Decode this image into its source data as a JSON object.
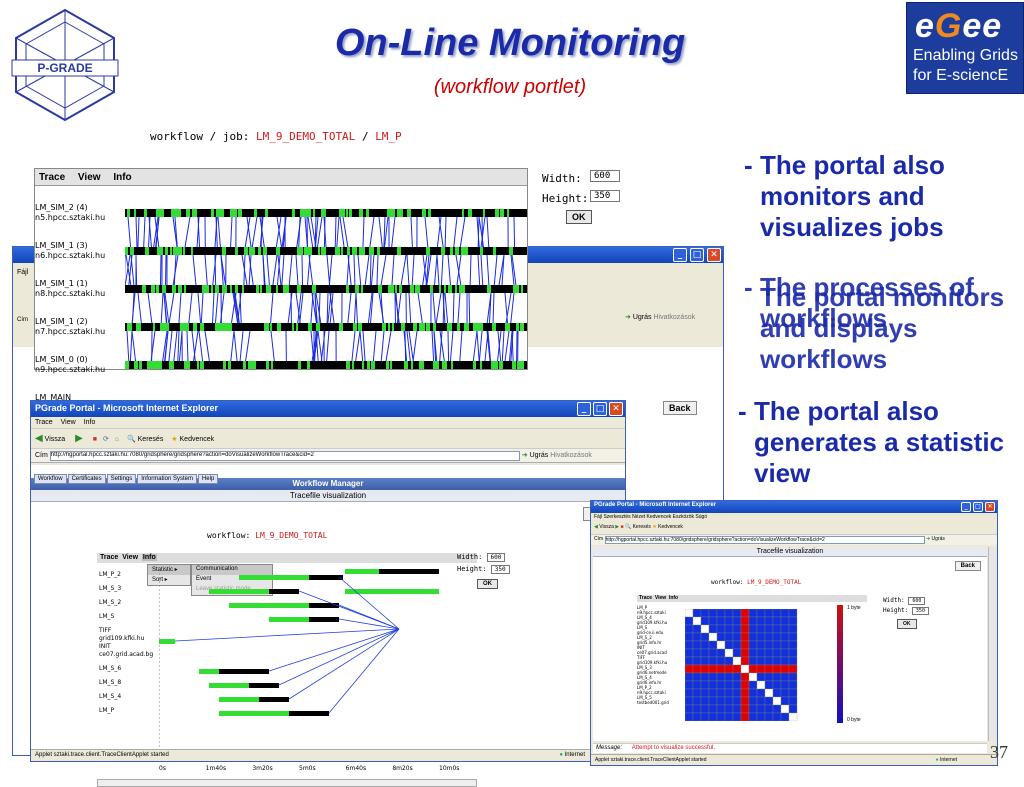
{
  "slide": {
    "title": "On-Line Monitoring",
    "subtitle": "(workflow portlet)",
    "page_number": "37",
    "bullets": [
      "The portal also monitors and visualizes jobs",
      "The processes of workflows",
      "The portal monitors and displays workflows",
      "The portal also generates a statistic view"
    ],
    "logos": {
      "left_logo_text": "P-GRADE",
      "right_logo_lines": [
        "egee",
        "Enabling Grids",
        "for E-sciencE"
      ]
    }
  },
  "trace_applet": {
    "workflow_job_label": "workflow / job:",
    "workflow_name": "LM_9_DEMO_TOTAL",
    "separator": "/",
    "job_name": "LM_P",
    "menu": [
      "Trace",
      "View",
      "Info"
    ],
    "width_label": "Width:",
    "width_value": "600",
    "height_label": "Height:",
    "height_value": "350",
    "ok_label": "OK",
    "lanes": [
      {
        "name": "LM_SIM_2 (4)",
        "host": "n5.hpcc.sztaki.hu"
      },
      {
        "name": "LM_SIM_1 (3)",
        "host": "n6.hpcc.sztaki.hu"
      },
      {
        "name": "LM_SIM_1 (1)",
        "host": "n8.hpcc.sztaki.hu"
      },
      {
        "name": "LM_SIM_1 (2)",
        "host": "n7.hpcc.sztaki.hu"
      },
      {
        "name": "LM_SIM_0 (0)",
        "host": "n9.hpcc.sztaki.hu"
      },
      {
        "name": "LM_MAIN",
        "host": ""
      }
    ]
  },
  "back_window": {
    "menu_fragment": "Fájl",
    "address_fragment": "Cím",
    "go_label": "Ugrás",
    "links_label": "Hivatkozások",
    "back_label": "Back"
  },
  "ie_window": {
    "title": "PGrade Portal - Microsoft Internet Explorer",
    "menu": [
      "Trace",
      "View",
      "Info"
    ],
    "toolbar": {
      "back": "Vissza",
      "search": "Keresés",
      "favorites": "Kedvencek"
    },
    "address_label": "Cím",
    "address": "http://hgportal.hpcc.sztaki.hu:7080/gridsphere/gridsphere?action=doVisualizeWorkflowTrace&cid=2",
    "go_label": "Ugrás",
    "links_label": "Hivatkozások",
    "tabs": [
      "Workflow",
      "Certificates",
      "Settings",
      "Information System",
      "Help"
    ],
    "manager_title": "Workflow Manager",
    "view_title": "Tracefile visualization",
    "back_label": "Back",
    "workflow_label": "workflow:",
    "workflow_name": "LM_9_DEMO_TOTAL",
    "dropdown_left": [
      "Statistic ▸",
      "Sort ▸"
    ],
    "dropdown_right": [
      "Communication",
      "Event",
      "Leave statistic mode"
    ],
    "width_label": "Width:",
    "width_value": "600",
    "height_label": "Height:",
    "height_value": "350",
    "ok_label": "OK",
    "lanes": [
      "LM_P_2",
      "LM_S_3",
      "LM_S_2",
      "LM_S",
      "TIFF",
      "grid109.kfki.hu",
      "INIT",
      "ce07.grid.acad.bg",
      "LM_S_6",
      "LM_S_8",
      "LM_S_4",
      "LM_P"
    ],
    "time_ticks": [
      "0s",
      "1m40s",
      "3m20s",
      "5m0s",
      "6m40s",
      "8m20s",
      "10m0s"
    ],
    "status": "Applet sztaki.trace.client.TraceClientApplet started",
    "zone": "Internet"
  },
  "stat_window": {
    "title": "PGrade Portal - Microsoft Internet Explorer",
    "address": "http://hgportal.hpcc.sztaki.hu:7080/gridsphere/gridsphere?action=doVisualizeWorkflowTrace&cid=2",
    "view_title": "Tracefile visualization",
    "back_label": "Back",
    "workflow_label": "workflow:",
    "workflow_name": "LM_9_DEMO_TOTAL",
    "menu": [
      "Trace",
      "View",
      "Info"
    ],
    "width_label": "Width:",
    "width_value": "600",
    "height_label": "Height:",
    "height_value": "350",
    "ok_label": "OK",
    "scale_max": "1 byte",
    "scale_min": "0 byte",
    "message_label": "Message:",
    "message": "Attempt to visualize successful.",
    "status": "Applet sztaki.trace.client.TraceClientApplet started",
    "zone": "Internet"
  }
}
